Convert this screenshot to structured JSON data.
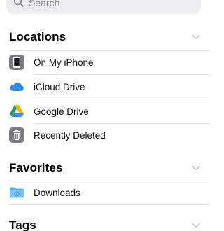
{
  "search": {
    "placeholder": "Search"
  },
  "locations": {
    "title": "Locations",
    "items": [
      {
        "label": "On My iPhone",
        "icon": "iphone-icon"
      },
      {
        "label": "iCloud Drive",
        "icon": "icloud-icon"
      },
      {
        "label": "Google Drive",
        "icon": "google-drive-icon"
      },
      {
        "label": "Recently Deleted",
        "icon": "trash-icon"
      }
    ]
  },
  "favorites": {
    "title": "Favorites",
    "items": [
      {
        "label": "Downloads",
        "icon": "folder-icon"
      }
    ]
  },
  "tags": {
    "title": "Tags"
  },
  "colors": {
    "accent": "#0a84ff",
    "separator": "#e3e3e6",
    "chevron": "#c7c7cc",
    "secondary_text": "#8e8e93"
  }
}
